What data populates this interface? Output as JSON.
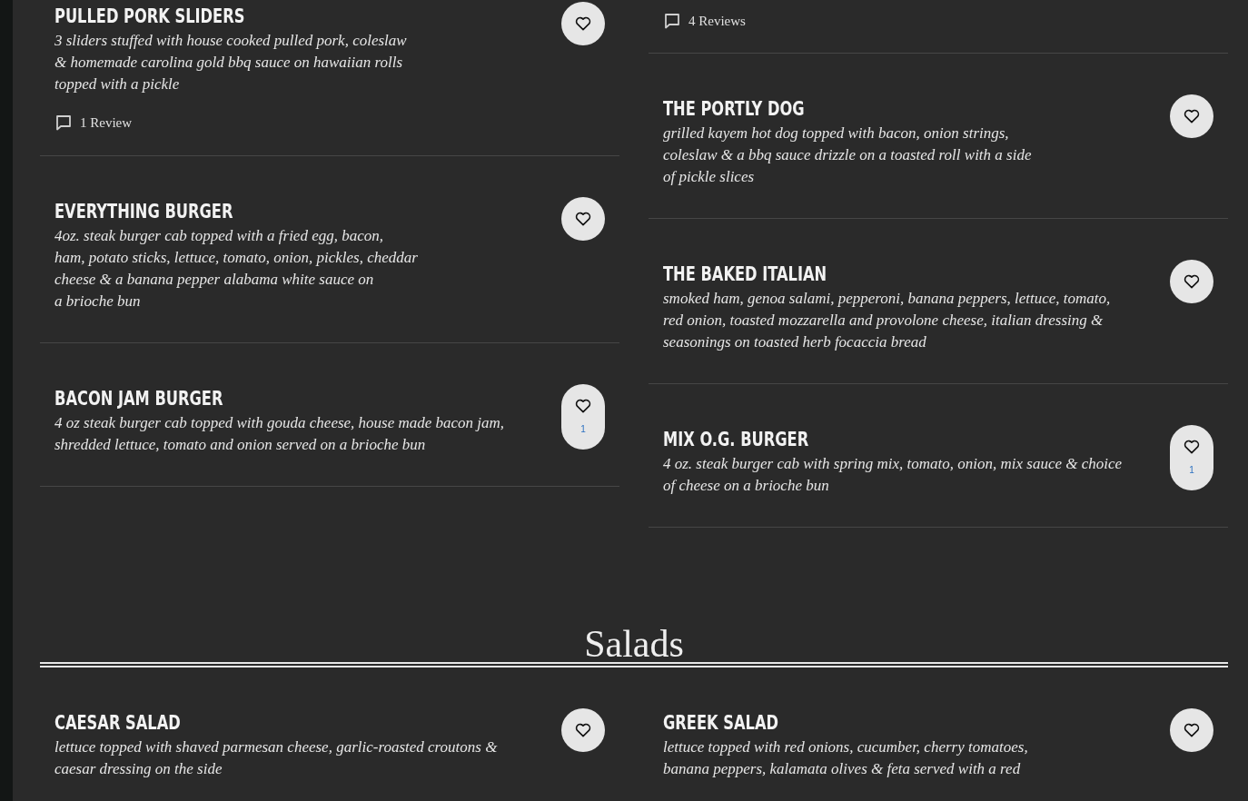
{
  "sections": [
    {
      "columns": [
        [
          {
            "name": "PULLED PORK SLIDERS",
            "description": [
              "3 sliders stuffed with house cooked pulled pork, coleslaw",
              "& homemade carolina gold bbq sauce on hawaiian rolls",
              "topped with a pickle"
            ],
            "reviews": "1 Review"
          },
          {
            "name": "EVERYTHING BURGER",
            "description": [
              "4oz. steak burger cab topped with a fried egg, bacon,",
              "ham, potato sticks, lettuce, tomato, onion, pickles, cheddar",
              "cheese & a banana pepper alabama white sauce on",
              "a brioche bun"
            ]
          },
          {
            "name": "BACON JAM BURGER",
            "description": [
              "4 oz steak burger cab topped with gouda cheese, house made bacon jam,",
              "shredded lettuce, tomato and onion served on a brioche bun"
            ],
            "likes": "1"
          }
        ],
        [
          {
            "reviews": "4 Reviews"
          },
          {
            "name": "THE PORTLY DOG",
            "description": [
              "grilled kayem hot dog topped with bacon, onion strings,",
              "coleslaw & a bbq sauce drizzle on a toasted roll with a side",
              "of pickle slices"
            ]
          },
          {
            "name": "THE BAKED ITALIAN",
            "description": [
              "smoked ham, genoa salami, pepperoni, banana peppers, lettuce, tomato,",
              "red onion, toasted mozzarella and provolone cheese, italian dressing &",
              "seasonings on toasted herb focaccia bread"
            ]
          },
          {
            "name": "MIX O.G. BURGER",
            "description": [
              "4 oz. steak burger cab with spring mix, tomato, onion, mix sauce & choice",
              "of cheese on a brioche bun"
            ],
            "likes": "1"
          }
        ]
      ]
    },
    {
      "heading": "Salads",
      "columns": [
        [
          {
            "name": "CAESAR SALAD",
            "description": [
              "lettuce topped with shaved parmesan cheese, garlic-roasted croutons &",
              "caesar dressing on the side"
            ]
          }
        ],
        [
          {
            "name": "GREEK SALAD",
            "description": [
              "lettuce topped with red onions, cucumber, cherry tomatoes,",
              "banana peppers, kalamata olives & feta served with a red"
            ]
          }
        ]
      ]
    }
  ]
}
